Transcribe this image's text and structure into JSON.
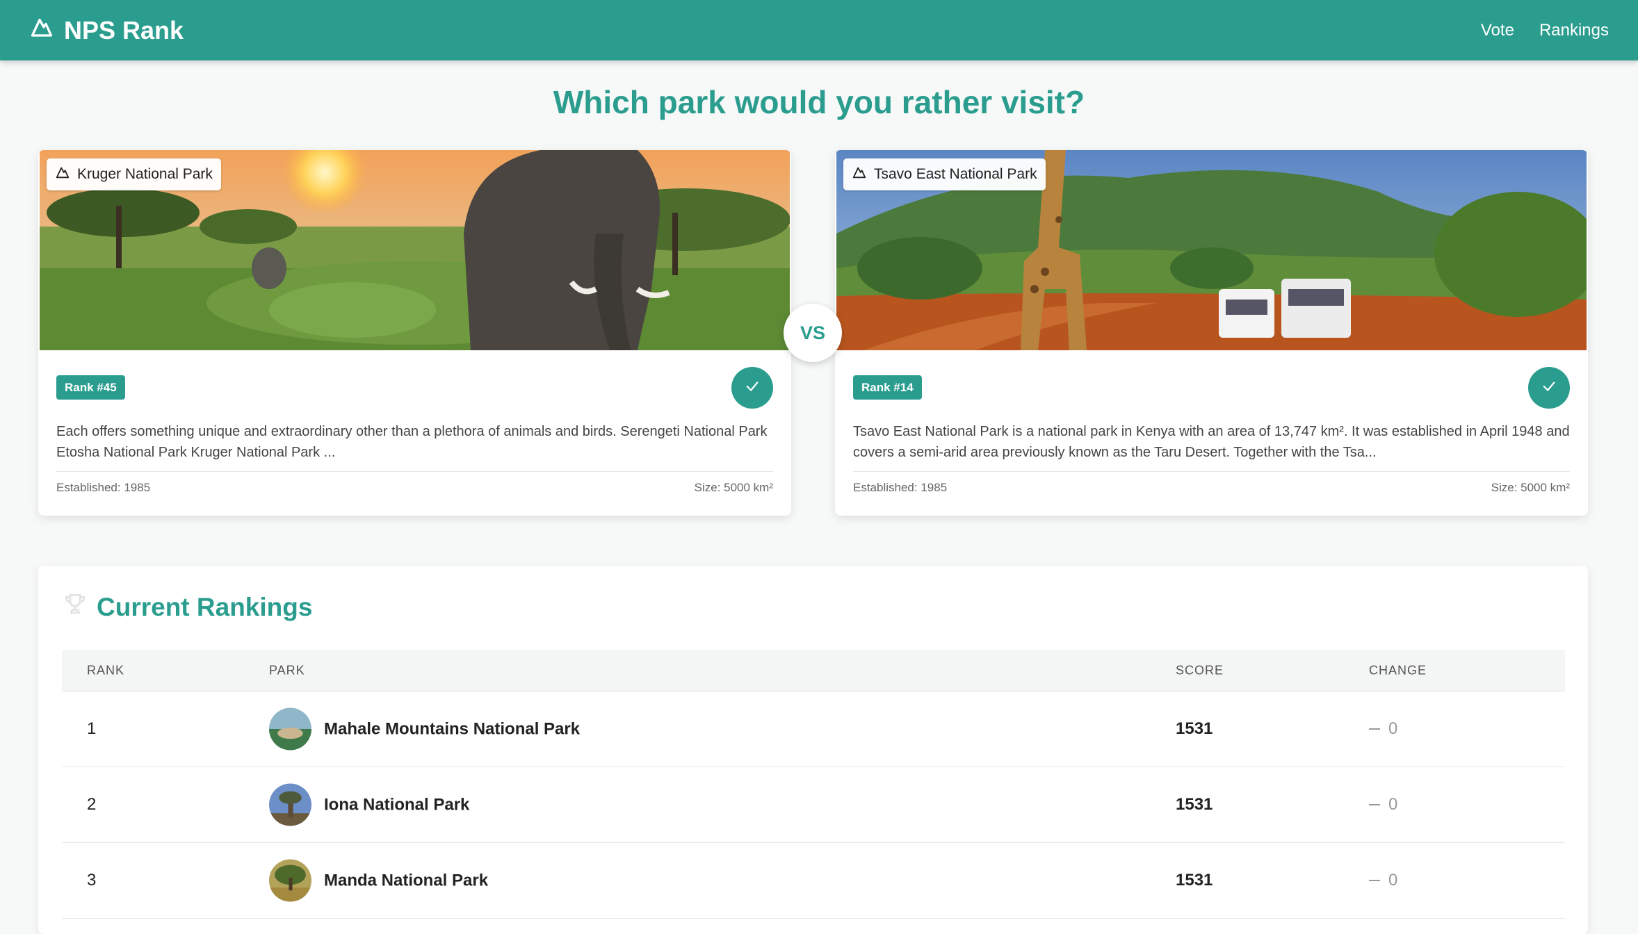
{
  "header": {
    "brand": "NPS Rank",
    "nav": [
      {
        "label": "Vote"
      },
      {
        "label": "Rankings"
      }
    ]
  },
  "page_title": "Which park would you rather visit?",
  "matchup": {
    "vs_label": "VS",
    "left": {
      "name": "Kruger National Park",
      "rank": "Rank #45",
      "description": "Each offers something unique and extraordinary other than a plethora of animals and birds. Serengeti National Park Etosha National Park Kruger National Park ...",
      "established": "Established: 1985",
      "size": "Size: 5000 km²"
    },
    "right": {
      "name": "Tsavo East National Park",
      "rank": "Rank #14",
      "description": "Tsavo East National Park is a national park in Kenya with an area of 13,747 km². It was established in April 1948 and covers a semi-arid area previously known as the Taru Desert. Together with the Tsa...",
      "established": "Established: 1985",
      "size": "Size: 5000 km²"
    }
  },
  "rankings": {
    "title": "Current Rankings",
    "columns": [
      "RANK",
      "PARK",
      "SCORE",
      "CHANGE"
    ],
    "rows": [
      {
        "rank": "1",
        "park": "Mahale Mountains National Park",
        "score": "1531",
        "change": "0"
      },
      {
        "rank": "2",
        "park": "Iona National Park",
        "score": "1531",
        "change": "0"
      },
      {
        "rank": "3",
        "park": "Manda National Park",
        "score": "1531",
        "change": "0"
      }
    ]
  },
  "colors": {
    "accent": "#2a9d8f",
    "background": "#f7f8f8"
  },
  "icons": {
    "brand": "mountain-icon",
    "chip": "mountain-icon",
    "select": "check-icon",
    "rankings_title": "trophy-icon",
    "change": "dash-icon"
  }
}
